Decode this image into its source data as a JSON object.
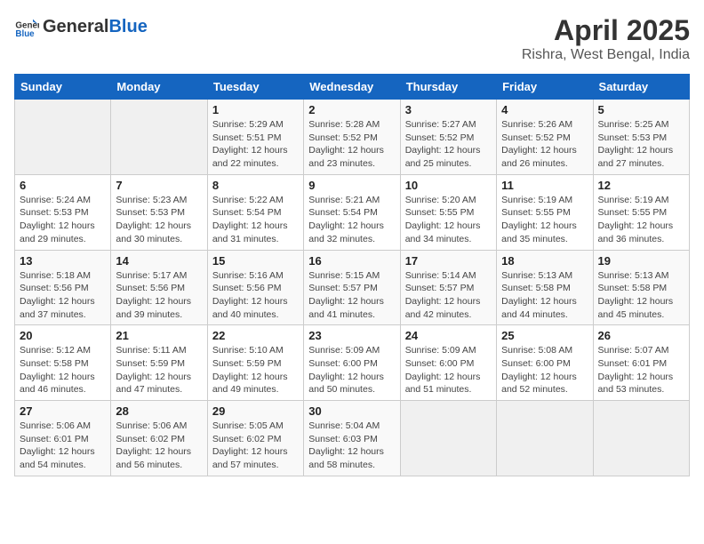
{
  "header": {
    "logo_general": "General",
    "logo_blue": "Blue",
    "title": "April 2025",
    "subtitle": "Rishra, West Bengal, India"
  },
  "calendar": {
    "weekdays": [
      "Sunday",
      "Monday",
      "Tuesday",
      "Wednesday",
      "Thursday",
      "Friday",
      "Saturday"
    ],
    "weeks": [
      [
        {
          "day": "",
          "info": ""
        },
        {
          "day": "",
          "info": ""
        },
        {
          "day": "1",
          "info": "Sunrise: 5:29 AM\nSunset: 5:51 PM\nDaylight: 12 hours and 22 minutes."
        },
        {
          "day": "2",
          "info": "Sunrise: 5:28 AM\nSunset: 5:52 PM\nDaylight: 12 hours and 23 minutes."
        },
        {
          "day": "3",
          "info": "Sunrise: 5:27 AM\nSunset: 5:52 PM\nDaylight: 12 hours and 25 minutes."
        },
        {
          "day": "4",
          "info": "Sunrise: 5:26 AM\nSunset: 5:52 PM\nDaylight: 12 hours and 26 minutes."
        },
        {
          "day": "5",
          "info": "Sunrise: 5:25 AM\nSunset: 5:53 PM\nDaylight: 12 hours and 27 minutes."
        }
      ],
      [
        {
          "day": "6",
          "info": "Sunrise: 5:24 AM\nSunset: 5:53 PM\nDaylight: 12 hours and 29 minutes."
        },
        {
          "day": "7",
          "info": "Sunrise: 5:23 AM\nSunset: 5:53 PM\nDaylight: 12 hours and 30 minutes."
        },
        {
          "day": "8",
          "info": "Sunrise: 5:22 AM\nSunset: 5:54 PM\nDaylight: 12 hours and 31 minutes."
        },
        {
          "day": "9",
          "info": "Sunrise: 5:21 AM\nSunset: 5:54 PM\nDaylight: 12 hours and 32 minutes."
        },
        {
          "day": "10",
          "info": "Sunrise: 5:20 AM\nSunset: 5:55 PM\nDaylight: 12 hours and 34 minutes."
        },
        {
          "day": "11",
          "info": "Sunrise: 5:19 AM\nSunset: 5:55 PM\nDaylight: 12 hours and 35 minutes."
        },
        {
          "day": "12",
          "info": "Sunrise: 5:19 AM\nSunset: 5:55 PM\nDaylight: 12 hours and 36 minutes."
        }
      ],
      [
        {
          "day": "13",
          "info": "Sunrise: 5:18 AM\nSunset: 5:56 PM\nDaylight: 12 hours and 37 minutes."
        },
        {
          "day": "14",
          "info": "Sunrise: 5:17 AM\nSunset: 5:56 PM\nDaylight: 12 hours and 39 minutes."
        },
        {
          "day": "15",
          "info": "Sunrise: 5:16 AM\nSunset: 5:56 PM\nDaylight: 12 hours and 40 minutes."
        },
        {
          "day": "16",
          "info": "Sunrise: 5:15 AM\nSunset: 5:57 PM\nDaylight: 12 hours and 41 minutes."
        },
        {
          "day": "17",
          "info": "Sunrise: 5:14 AM\nSunset: 5:57 PM\nDaylight: 12 hours and 42 minutes."
        },
        {
          "day": "18",
          "info": "Sunrise: 5:13 AM\nSunset: 5:58 PM\nDaylight: 12 hours and 44 minutes."
        },
        {
          "day": "19",
          "info": "Sunrise: 5:13 AM\nSunset: 5:58 PM\nDaylight: 12 hours and 45 minutes."
        }
      ],
      [
        {
          "day": "20",
          "info": "Sunrise: 5:12 AM\nSunset: 5:58 PM\nDaylight: 12 hours and 46 minutes."
        },
        {
          "day": "21",
          "info": "Sunrise: 5:11 AM\nSunset: 5:59 PM\nDaylight: 12 hours and 47 minutes."
        },
        {
          "day": "22",
          "info": "Sunrise: 5:10 AM\nSunset: 5:59 PM\nDaylight: 12 hours and 49 minutes."
        },
        {
          "day": "23",
          "info": "Sunrise: 5:09 AM\nSunset: 6:00 PM\nDaylight: 12 hours and 50 minutes."
        },
        {
          "day": "24",
          "info": "Sunrise: 5:09 AM\nSunset: 6:00 PM\nDaylight: 12 hours and 51 minutes."
        },
        {
          "day": "25",
          "info": "Sunrise: 5:08 AM\nSunset: 6:00 PM\nDaylight: 12 hours and 52 minutes."
        },
        {
          "day": "26",
          "info": "Sunrise: 5:07 AM\nSunset: 6:01 PM\nDaylight: 12 hours and 53 minutes."
        }
      ],
      [
        {
          "day": "27",
          "info": "Sunrise: 5:06 AM\nSunset: 6:01 PM\nDaylight: 12 hours and 54 minutes."
        },
        {
          "day": "28",
          "info": "Sunrise: 5:06 AM\nSunset: 6:02 PM\nDaylight: 12 hours and 56 minutes."
        },
        {
          "day": "29",
          "info": "Sunrise: 5:05 AM\nSunset: 6:02 PM\nDaylight: 12 hours and 57 minutes."
        },
        {
          "day": "30",
          "info": "Sunrise: 5:04 AM\nSunset: 6:03 PM\nDaylight: 12 hours and 58 minutes."
        },
        {
          "day": "",
          "info": ""
        },
        {
          "day": "",
          "info": ""
        },
        {
          "day": "",
          "info": ""
        }
      ]
    ]
  }
}
